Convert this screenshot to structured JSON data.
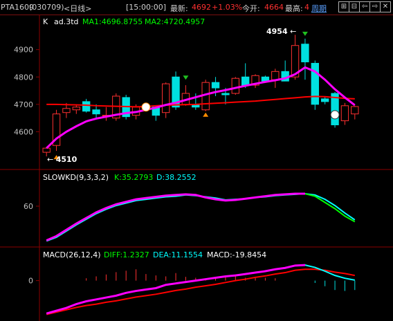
{
  "header": {
    "symbol": "PTA1609",
    "code": "(030709)",
    "period": "<日线>",
    "time": "[15:00:00]",
    "latest_label": "最新:",
    "latest_value": "4692",
    "change": "+1.03%",
    "open_label": "今开:",
    "open_value": "4664",
    "high_label": "最高:",
    "high_value": "4",
    "tab_label": "周期"
  },
  "toolbar_icons": [
    "zoom-in-icon",
    "zoom-out-icon",
    "arrow-left-icon",
    "arrow-right-icon",
    "close-icon"
  ],
  "main_panel": {
    "prefix": "K",
    "indicator": "ad.3td",
    "ma1_label": "MA1:4696.8755",
    "ma2_label": "MA2:4720.4957",
    "high_marker": "4954",
    "low_marker": "4510",
    "y_ticks": [
      "4900",
      "4800",
      "4700",
      "4600"
    ]
  },
  "kd_panel": {
    "title": "SLOWKD(9,3,3,2)",
    "k_label": "K:35.2793",
    "d_label": "D:38.2552",
    "y_tick": "60"
  },
  "macd_panel": {
    "title": "MACD(26,12,4)",
    "diff_label": "DIFF:1.2327",
    "dea_label": "DEA:11.1554",
    "macd_label": "MACD:-19.8454",
    "y_tick": "0"
  },
  "colors": {
    "up": "#ff3030",
    "down": "#00e0e0",
    "ma_trend": "#ff00ff",
    "ma_long": "#ff0000",
    "ma_short": "#00ff00",
    "grid_line": "#8b0000",
    "accent_label": "#ffff00"
  },
  "chart_data": {
    "type": "candlestick",
    "candles": [
      {
        "o": 4525,
        "h": 4545,
        "l": 4510,
        "c": 4540
      },
      {
        "o": 4550,
        "h": 4680,
        "l": 4530,
        "c": 4665
      },
      {
        "o": 4670,
        "h": 4705,
        "l": 4650,
        "c": 4685
      },
      {
        "o": 4680,
        "h": 4700,
        "l": 4665,
        "c": 4690
      },
      {
        "o": 4710,
        "h": 4720,
        "l": 4670,
        "c": 4675
      },
      {
        "o": 4680,
        "h": 4700,
        "l": 4650,
        "c": 4665
      },
      {
        "o": 4660,
        "h": 4690,
        "l": 4640,
        "c": 4660
      },
      {
        "o": 4650,
        "h": 4740,
        "l": 4640,
        "c": 4730
      },
      {
        "o": 4725,
        "h": 4735,
        "l": 4645,
        "c": 4655
      },
      {
        "o": 4660,
        "h": 4700,
        "l": 4645,
        "c": 4690
      },
      {
        "o": 4690,
        "h": 4700,
        "l": 4675,
        "c": 4690
      },
      {
        "o": 4690,
        "h": 4695,
        "l": 4640,
        "c": 4660
      },
      {
        "o": 4670,
        "h": 4780,
        "l": 4650,
        "c": 4775
      },
      {
        "o": 4800,
        "h": 4820,
        "l": 4680,
        "c": 4690
      },
      {
        "o": 4700,
        "h": 4770,
        "l": 4695,
        "c": 4740
      },
      {
        "o": 4700,
        "h": 4740,
        "l": 4680,
        "c": 4690
      },
      {
        "o": 4680,
        "h": 4790,
        "l": 4675,
        "c": 4780
      },
      {
        "o": 4780,
        "h": 4800,
        "l": 4730,
        "c": 4760
      },
      {
        "o": 4740,
        "h": 4760,
        "l": 4700,
        "c": 4735
      },
      {
        "o": 4740,
        "h": 4800,
        "l": 4735,
        "c": 4795
      },
      {
        "o": 4800,
        "h": 4850,
        "l": 4760,
        "c": 4770
      },
      {
        "o": 4770,
        "h": 4810,
        "l": 4760,
        "c": 4805
      },
      {
        "o": 4800,
        "h": 4805,
        "l": 4780,
        "c": 4785
      },
      {
        "o": 4790,
        "h": 4830,
        "l": 4760,
        "c": 4820
      },
      {
        "o": 4820,
        "h": 4860,
        "l": 4785,
        "c": 4785
      },
      {
        "o": 4800,
        "h": 4954,
        "l": 4790,
        "c": 4915
      },
      {
        "o": 4920,
        "h": 4940,
        "l": 4790,
        "c": 4855
      },
      {
        "o": 4850,
        "h": 4860,
        "l": 4680,
        "c": 4700
      },
      {
        "o": 4720,
        "h": 4730,
        "l": 4700,
        "c": 4710
      },
      {
        "o": 4740,
        "h": 4745,
        "l": 4615,
        "c": 4625
      },
      {
        "o": 4640,
        "h": 4705,
        "l": 4625,
        "c": 4695
      },
      {
        "o": 4665,
        "h": 4695,
        "l": 4645,
        "c": 4692
      }
    ],
    "ma1": [
      4540,
      4575,
      4600,
      4620,
      4638,
      4648,
      4655,
      4662,
      4668,
      4672,
      4680,
      4688,
      4698,
      4706,
      4716,
      4726,
      4736,
      4745,
      4752,
      4760,
      4768,
      4775,
      4782,
      4788,
      4795,
      4810,
      4835,
      4820,
      4790,
      4755,
      4725,
      4697
    ],
    "ma2": [
      4700,
      4700,
      4699,
      4698,
      4697,
      4695,
      4694,
      4693,
      4692,
      4691,
      4692,
      4695,
      4697,
      4698,
      4699,
      4700,
      4702,
      4704,
      4706,
      4708,
      4710,
      4712,
      4715,
      4718,
      4721,
      4724,
      4727,
      4729,
      4728,
      4725,
      4722,
      4720
    ],
    "kd_k": [
      5,
      12,
      22,
      32,
      41,
      50,
      57,
      63,
      67,
      71,
      73,
      75,
      77,
      78,
      79,
      78,
      74,
      71,
      69,
      70,
      72,
      74,
      76,
      78,
      79,
      80,
      80,
      76,
      66,
      56,
      44,
      35
    ],
    "kd_d": [
      4,
      10,
      20,
      30,
      39,
      48,
      55,
      61,
      65,
      69,
      71,
      73,
      75,
      76,
      78,
      77,
      75,
      73,
      70,
      71,
      72,
      74,
      75,
      77,
      78,
      79,
      80,
      78,
      71,
      61,
      49,
      38
    ],
    "macd_diff": [
      -70,
      -64,
      -58,
      -50,
      -44,
      -40,
      -36,
      -32,
      -26,
      -22,
      -19,
      -16,
      -9,
      -6,
      -3,
      0,
      3,
      6,
      9,
      11,
      14,
      17,
      20,
      24,
      27,
      32,
      33,
      28,
      20,
      11,
      5,
      1
    ],
    "macd_dea": [
      -72,
      -67,
      -62,
      -57,
      -53,
      -50,
      -46,
      -43,
      -39,
      -35,
      -32,
      -29,
      -25,
      -21,
      -18,
      -14,
      -11,
      -8,
      -4,
      0,
      3,
      7,
      10,
      14,
      17,
      22,
      24,
      24,
      22,
      18,
      15,
      11
    ],
    "macd_hist": [
      0,
      0,
      0,
      0,
      5,
      9,
      13,
      18,
      21,
      24,
      14,
      11,
      9,
      16,
      8,
      6,
      4,
      8,
      8,
      10,
      6,
      7,
      6,
      5,
      0,
      0,
      0,
      -5,
      -12,
      -20,
      -22,
      -20
    ],
    "y_range_main": [
      4500,
      4980
    ],
    "y_range_kd": [
      0,
      100
    ],
    "y_range_macd": [
      -80,
      45
    ]
  }
}
